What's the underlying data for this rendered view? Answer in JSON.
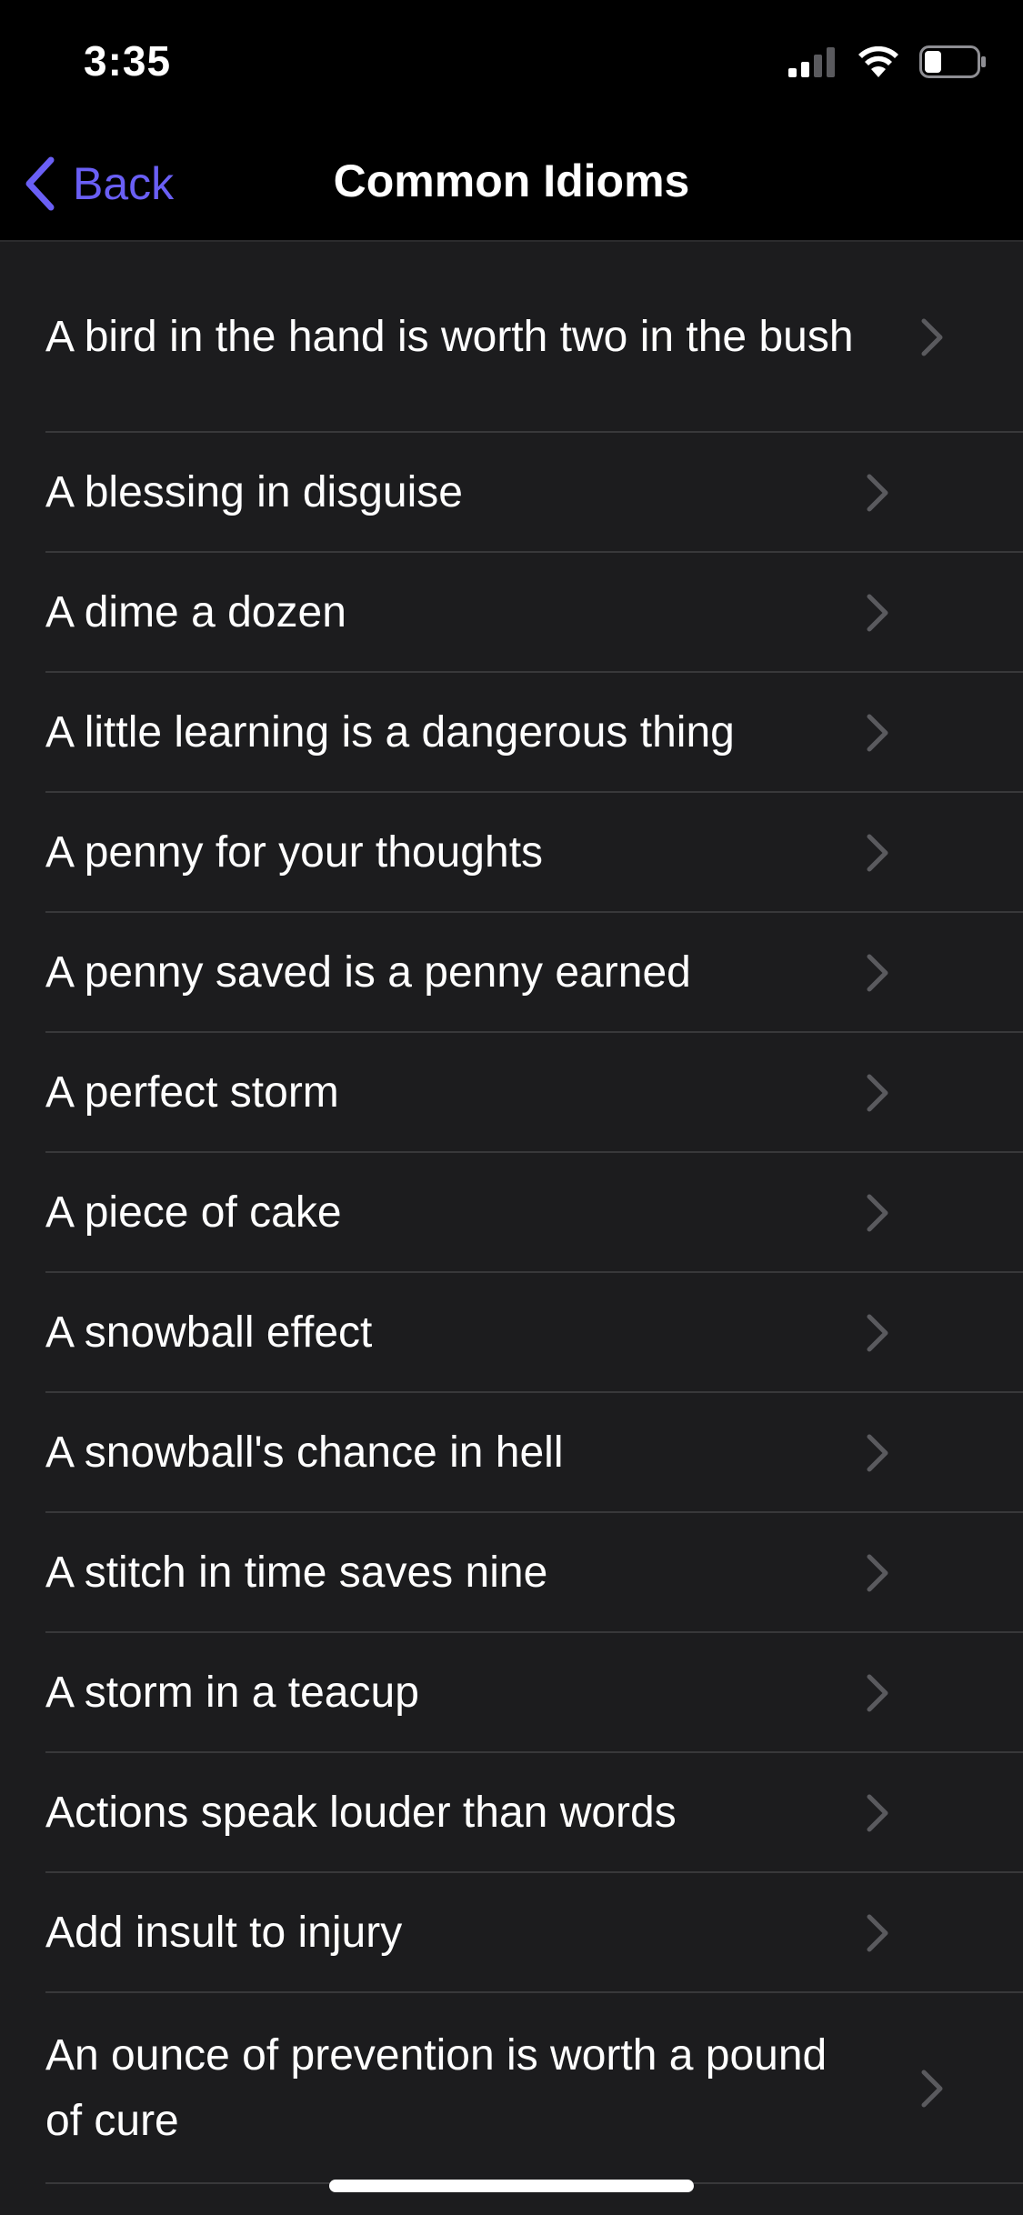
{
  "status_bar": {
    "time": "3:35",
    "icons": [
      "cellular-signal-icon",
      "wifi-icon",
      "battery-icon"
    ]
  },
  "nav": {
    "back_label": "Back",
    "title": "Common Idioms"
  },
  "colors": {
    "accent": "#6a5ff5",
    "background": "#000000",
    "list_background": "#1c1c1e",
    "separator": "#38383a",
    "chevron": "#5a5a5e"
  },
  "idioms": [
    "A bird in the hand is worth two in the bush",
    "A blessing in disguise",
    "A dime a dozen",
    "A little learning is a dangerous thing",
    "A penny for your thoughts",
    "A penny saved is a penny earned",
    "A perfect storm",
    "A piece of cake",
    "A snowball effect",
    "A snowball's chance in hell",
    "A stitch in time saves nine",
    "A storm in a teacup",
    "Actions speak louder than words",
    "Add insult to injury",
    "An ounce of prevention is worth a pound of cure"
  ]
}
